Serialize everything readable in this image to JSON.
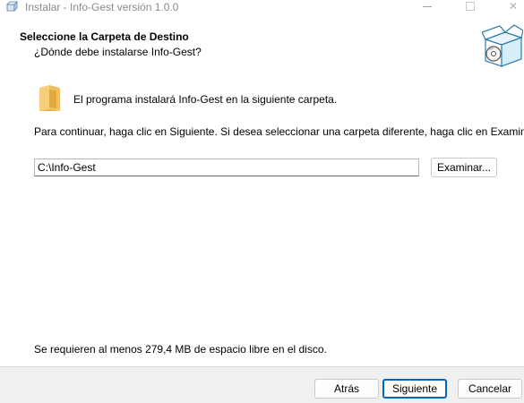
{
  "window": {
    "title": "Instalar - Info-Gest versión 1.0.0",
    "icon": "installer-app-icon",
    "controls": [
      "minimize",
      "maximize",
      "close"
    ]
  },
  "header": {
    "title": "Seleccione la Carpeta de Destino",
    "subtitle": "¿Dónde debe instalarse Info-Gest?",
    "icon": "setup-box-icon"
  },
  "body": {
    "folder_icon": "folder-icon",
    "intro": "El programa instalará Info-Gest en la siguiente carpeta.",
    "instruction": "Para continuar, haga clic en Siguiente. Si desea seleccionar una carpeta diferente, haga clic en Examinar.",
    "path_value": "C:\\Info-Gest",
    "browse_label": "Examinar...",
    "space_required": "Se requieren al menos 279,4 MB de espacio libre en el disco."
  },
  "footer": {
    "back_label": "Atrás",
    "next_label": "Siguiente",
    "cancel_label": "Cancelar"
  },
  "colors": {
    "accent": "#0067c0",
    "footer_bg": "#f0f0f0",
    "title_text": "#8a8a8a"
  }
}
